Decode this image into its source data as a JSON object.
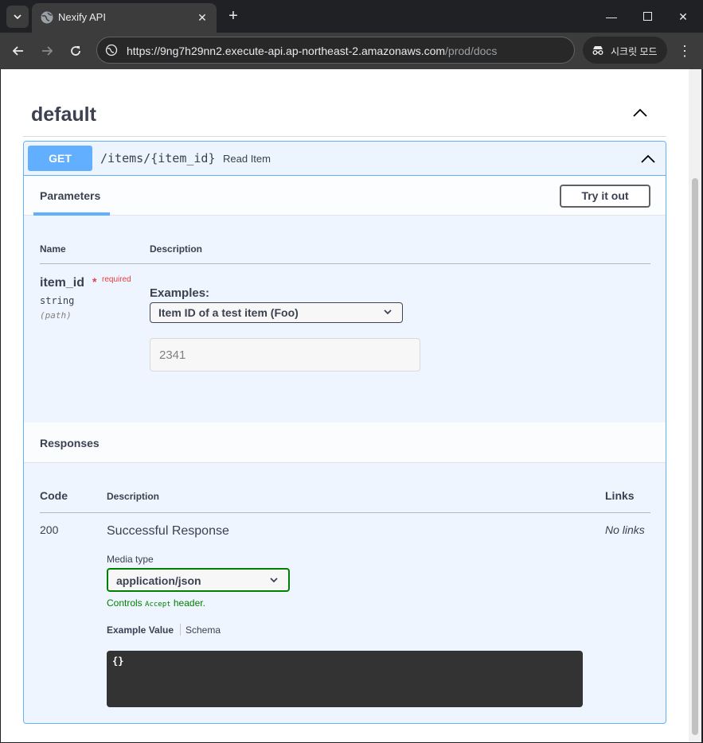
{
  "browser": {
    "tab_title": "Nexify API",
    "url_main": "https://9ng7h29nn2.execute-api.ap-northeast-2.amazonaws.com",
    "url_path": "/prod/docs",
    "incognito_label": "시크릿 모드"
  },
  "section": {
    "title": "default"
  },
  "operation": {
    "method": "GET",
    "path": "/items/{item_id}",
    "summary": "Read Item",
    "params_tab": "Parameters",
    "try_button": "Try it out"
  },
  "parameters": {
    "col_name": "Name",
    "col_description": "Description",
    "name": "item_id",
    "required_star": "*",
    "required_label": "required",
    "type": "string",
    "location": "(path)",
    "examples_label": "Examples:",
    "example_selected": "Item ID of a test item (Foo)",
    "input_value": "2341"
  },
  "responses": {
    "title": "Responses",
    "col_code": "Code",
    "col_description": "Description",
    "col_links": "Links",
    "code": "200",
    "description": "Successful Response",
    "links": "No links",
    "media_type_label": "Media type",
    "media_type_value": "application/json",
    "controls_prefix": "Controls ",
    "controls_code": "Accept",
    "controls_suffix": " header.",
    "example_tab": "Example Value",
    "schema_tab": "Schema",
    "example_body": "{}"
  },
  "colors": {
    "get_method": "#61affe",
    "block_bg": "#eef5fe",
    "text": "#3b4151",
    "required": "#e34040",
    "media_border": "#008000"
  }
}
